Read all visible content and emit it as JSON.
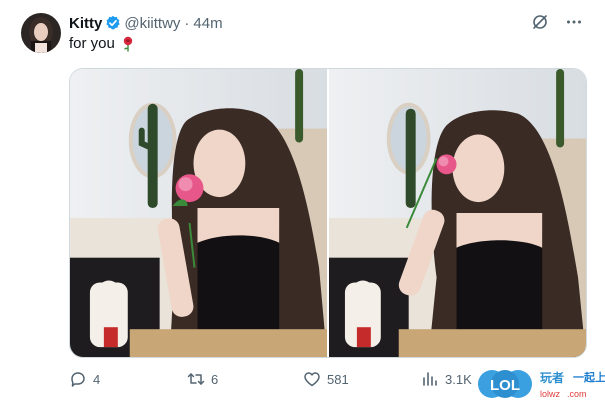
{
  "user": {
    "display_name": "Kitty",
    "handle": "@kiittwy",
    "separator": "·",
    "time_ago": "44m",
    "verified": true
  },
  "tweet": {
    "text": "for you",
    "emoji_icon": "rose-icon"
  },
  "media": {
    "count": 2,
    "photos": [
      "photo-1",
      "photo-2"
    ]
  },
  "actions": {
    "replies": "4",
    "retweets": "6",
    "likes": "581",
    "views": "3.1K"
  },
  "watermark": {
    "logo_text": "LOL",
    "line1": "一起上",
    "line2": "lolwz"
  },
  "colors": {
    "text": "#0f1419",
    "secondary": "#536471",
    "verified_blue": "#1d9bf0",
    "rose_pink": "#e8578a"
  },
  "icons": [
    "verified-icon",
    "grok-icon",
    "more-icon",
    "reply-icon",
    "retweet-icon",
    "like-icon",
    "views-icon",
    "rose-icon"
  ]
}
